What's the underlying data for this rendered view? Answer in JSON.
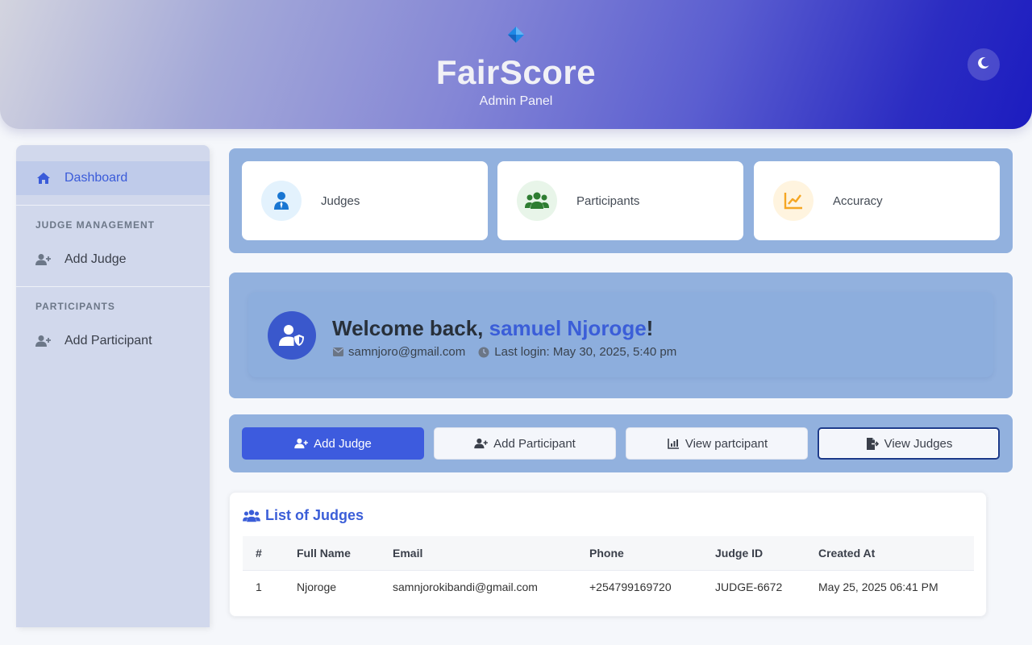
{
  "header": {
    "title": "FairScore",
    "subtitle": "Admin Panel",
    "logo_icon": "diamond-icon",
    "theme_toggle_icon": "moon-icon"
  },
  "sidebar": {
    "dashboard": "Dashboard",
    "section_judges": "JUDGE MANAGEMENT",
    "add_judge": "Add Judge",
    "section_participants": "PARTICIPANTS",
    "add_participant": "Add Participant"
  },
  "stats": [
    {
      "label": "Judges",
      "icon": "judge-icon",
      "color": "#1976d2",
      "bg": "#e3f2fd"
    },
    {
      "label": "Participants",
      "icon": "users-icon",
      "color": "#2e7d32",
      "bg": "#e8f5e9"
    },
    {
      "label": "Accuracy",
      "icon": "chart-line-icon",
      "color": "#f5a623",
      "bg": "#fff4df"
    }
  ],
  "welcome": {
    "greeting": "Welcome back, ",
    "name": "samuel Njoroge",
    "exclaim": "!",
    "email": "samnjoro@gmail.com",
    "last_login": "Last login: May 30, 2025, 5:40 pm"
  },
  "actions": {
    "add_judge": "Add Judge",
    "add_participant": "Add Participant",
    "view_participant": "View partcipant",
    "view_judges": "View Judges"
  },
  "judges_table": {
    "title": "List of Judges",
    "columns": [
      "#",
      "Full Name",
      "Email",
      "Phone",
      "Judge ID",
      "Created At"
    ],
    "rows": [
      [
        "1",
        "Njoroge",
        "samnjorokibandi@gmail.com",
        "+254799169720",
        "JUDGE-6672",
        "May 25, 2025 06:41 PM"
      ]
    ]
  },
  "colors": {
    "accent": "#3b5ed8",
    "panel": "#92b1de",
    "sidebar": "#d1d8ec"
  }
}
